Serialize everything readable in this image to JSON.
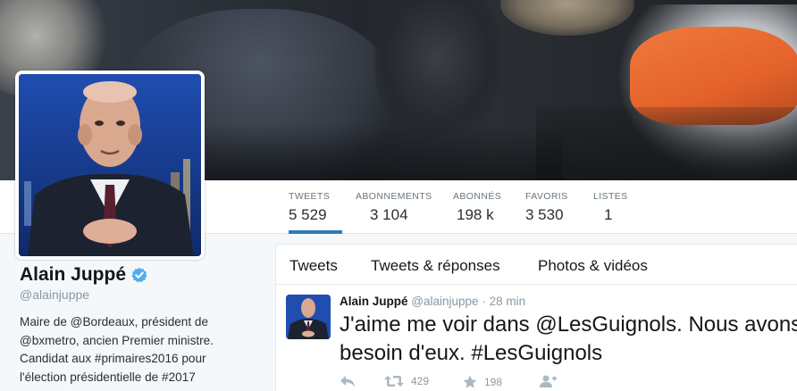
{
  "profile": {
    "name": "Alain Juppé",
    "handle": "@alainjuppe",
    "bio_parts": {
      "p1": "Maire de ",
      "l1": "@Bordeaux",
      "p2": ", président de ",
      "l2": "@bxmetro",
      "p3": ", ancien Premier ministre. Candidat aux ",
      "l3": "#primaires2016",
      "p4": " pour l'élection présidentielle de ",
      "l4": "#2017"
    }
  },
  "stats": [
    {
      "label": "TWEETS",
      "value": "5 529"
    },
    {
      "label": "ABONNEMENTS",
      "value": "3 104"
    },
    {
      "label": "ABONNÉS",
      "value": "198 k"
    },
    {
      "label": "FAVORIS",
      "value": "3 530"
    },
    {
      "label": "LISTES",
      "value": "1"
    }
  ],
  "tabs": [
    {
      "label": "Tweets"
    },
    {
      "label": "Tweets & réponses"
    },
    {
      "label": "Photos & vidéos"
    }
  ],
  "tweet": {
    "name": "Alain Juppé",
    "handle": "@alainjuppe",
    "separator": "·",
    "time": "28 min",
    "text": "J'aime me voir dans @LesGuignols. Nous avons besoin d'eux. #LesGuignols",
    "retweets": "429",
    "favorites": "198"
  },
  "icons": {
    "verified": "verified-badge-icon",
    "reply": "reply-icon",
    "retweet": "retweet-icon",
    "favorite": "star-icon",
    "follow": "follow-icon"
  },
  "colors": {
    "accent": "#2b7bb9",
    "verified": "#55acee"
  }
}
